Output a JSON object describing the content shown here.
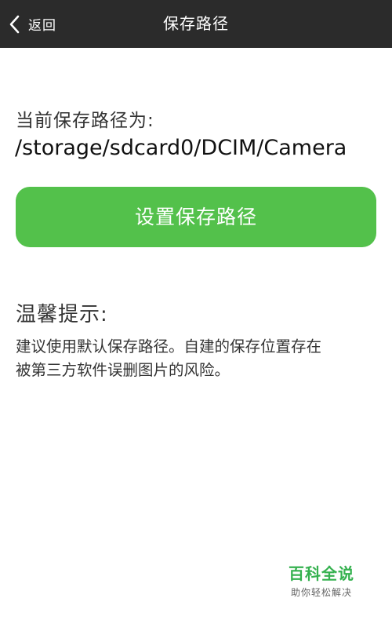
{
  "header": {
    "back_label": "返回",
    "back_icon": "chevron-left-icon",
    "title": "保存路径"
  },
  "main": {
    "path_label": "当前保存路径为:",
    "path_value": "/storage/sdcard0/DCIM/Camera",
    "set_button_label": "设置保存路径",
    "tip_title": "温馨提示:",
    "tip_lines": [
      "建议使用默认保存路径。自建的保存位置存在",
      "被第三方软件误删图片的风险。"
    ]
  },
  "watermark": {
    "title": "百科全说",
    "subtitle": "助你轻松解决"
  },
  "colors": {
    "header_bg": "#2b2b2b",
    "button_green": "#53c14b",
    "watermark_green": "#35b14f"
  }
}
